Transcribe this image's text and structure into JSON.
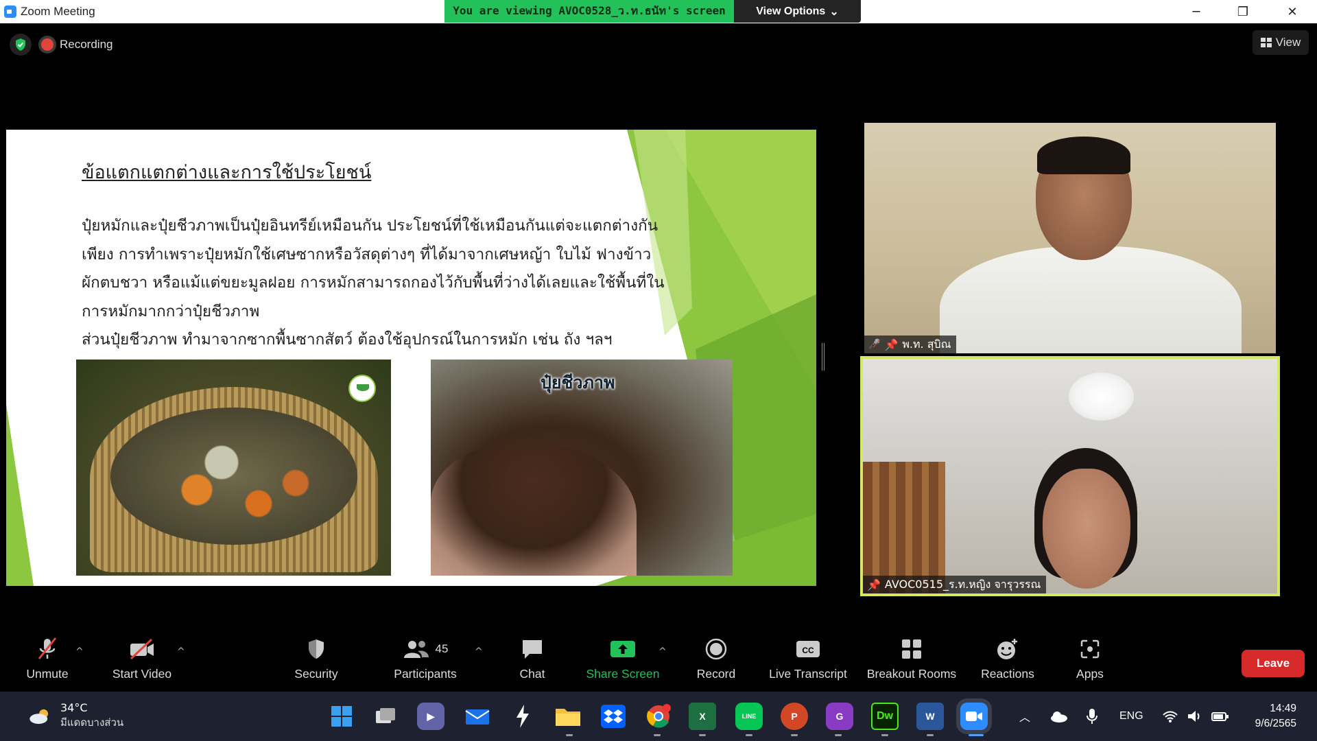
{
  "window": {
    "title": "Zoom Meeting"
  },
  "share_banner": {
    "text": "You are viewing AVOC0528_ว.ท.ธนัท's screen",
    "view_options": "View Options"
  },
  "status": {
    "recording": "Recording",
    "view": "View"
  },
  "slide": {
    "title": "ข้อแตกแตกต่างและการใช้ประโยชน์",
    "lines": [
      "ปุ๋ยหมักและปุ๋ยชีวภาพเป็นปุ๋ยอินทรีย์เหมือนกัน ประโยชน์ที่ใช้เหมือนกันแต่จะแตกต่างกัน",
      "เพียง การทำเพราะปุ๋ยหมักใช้เศษซากหรือวัสดุต่างๆ ที่ได้มาจากเศษหญ้า ใบไม้ ฟางข้าว",
      "ผักตบชวา หรือแม้แต่ขยะมูลฝอย การหมักสามารถกองไว้กับพื้นที่ว่างได้เลยและใช้พื้นที่ใน",
      "การหมักมากกว่าปุ๋ยชีวภาพ",
      "ส่วนปุ๋ยชีวภาพ ทำมาจากซากพื้นซากสัตว์ ต้องใช้อุปกรณ์ในการหมัก เช่น ถัง ฯลฯ"
    ],
    "photo_caption": "ปุ๋ยชีวภาพ"
  },
  "participants": [
    {
      "name": "พ.ท. สุบิณ",
      "muted": true,
      "pinned": true
    },
    {
      "name": "AVOC0515_ร.ท.หญิง จารุวรรณ",
      "muted": false,
      "pinned": true,
      "active_speaker": true
    }
  ],
  "toolbar": {
    "unmute": "Unmute",
    "start_video": "Start Video",
    "security": "Security",
    "participants": "Participants",
    "participants_count": "45",
    "chat": "Chat",
    "share_screen": "Share Screen",
    "record": "Record",
    "live_transcript": "Live Transcript",
    "breakout_rooms": "Breakout Rooms",
    "reactions": "Reactions",
    "apps": "Apps",
    "leave": "Leave"
  },
  "taskbar": {
    "temperature": "34°C",
    "condition": "มีแดดบางส่วน",
    "language": "ENG",
    "time": "14:49",
    "date": "9/6/2565"
  },
  "colors": {
    "zoom_blue": "#2d8cff",
    "share_green": "#23c15a",
    "leave_red": "#d62a2a",
    "speaker_border": "#d5e866"
  }
}
